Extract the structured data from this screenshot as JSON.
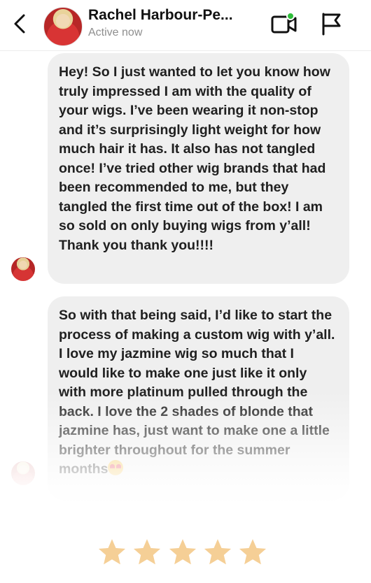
{
  "header": {
    "contact_name": "Rachel Harbour-Pe...",
    "status": "Active now",
    "icons": {
      "back": "chevron-left-icon",
      "video": "video-call-icon",
      "flag": "flag-icon"
    },
    "online_dot_color": "#2fbf3b"
  },
  "messages": [
    {
      "text": "Hey! So I just wanted to let you know how truly impressed I am with the quality of your wigs. I’ve been wearing it non-stop and it’s surprisingly light weight for how much hair it has. It also has not tangled once! I’ve tried other wig brands that had been recommended to me, but they tangled the first time out of the box! I am so sold on only buying wigs from y’all! Thank you thank you!!!!"
    },
    {
      "text": "So with that being said, I’d like to start the process of making a custom wig with y’all. I love my jazmine wig so much that I would like to make one just like it only with more platinum pulled through the back. I love the 2 shades of blonde that jazmine has, just want to make one a little brighter throughout for the summer months",
      "emoji": "heart-eyes-emoji"
    }
  ],
  "rating": {
    "stars": 5,
    "max": 5,
    "color": "#f5cf96"
  },
  "colors": {
    "bubble": "#efefef",
    "text": "#202020",
    "status": "#8e8e8e"
  }
}
